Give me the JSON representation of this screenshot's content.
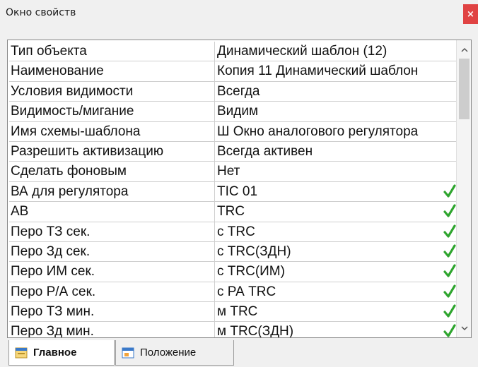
{
  "window": {
    "title": "Окно свойств",
    "close_label": "×"
  },
  "properties": [
    {
      "name": "Тип объекта",
      "value": "Динамический шаблон (12)",
      "check": false
    },
    {
      "name": "Наименование",
      "value": "Копия 11 Динамический шаблон",
      "check": false
    },
    {
      "name": "Условия видимости",
      "value": "Всегда",
      "check": false
    },
    {
      "name": "Видимость/мигание",
      "value": "Видим",
      "check": false
    },
    {
      "name": "Имя схемы-шаблона",
      "value": "Ш Окно аналогового регулятора",
      "check": false
    },
    {
      "name": "Разрешить активизацию",
      "value": "Всегда активен",
      "check": false
    },
    {
      "name": "Сделать фоновым",
      "value": "Нет",
      "check": false
    },
    {
      "name": "ВА для регулятора",
      "value": "TIC 01",
      "check": true
    },
    {
      "name": "АВ",
      "value": "TRC",
      "check": true
    },
    {
      "name": "Перо ТЗ сек.",
      "value": "с TRC",
      "check": true
    },
    {
      "name": "Перо Зд сек.",
      "value": "с TRC(ЗДН)",
      "check": true
    },
    {
      "name": "Перо ИМ сек.",
      "value": "с TRC(ИМ)",
      "check": true
    },
    {
      "name": "Перо Р/А сек.",
      "value": "с РА TRC",
      "check": true
    },
    {
      "name": "Перо ТЗ мин.",
      "value": "м TRC",
      "check": true
    },
    {
      "name": "Перо Зд мин.",
      "value": "м TRC(ЗДН)",
      "check": true
    }
  ],
  "tabs": [
    {
      "label": "Главное",
      "active": true
    },
    {
      "label": "Положение",
      "active": false
    }
  ],
  "colors": {
    "check": "#2fa52f",
    "close": "#e04343"
  }
}
